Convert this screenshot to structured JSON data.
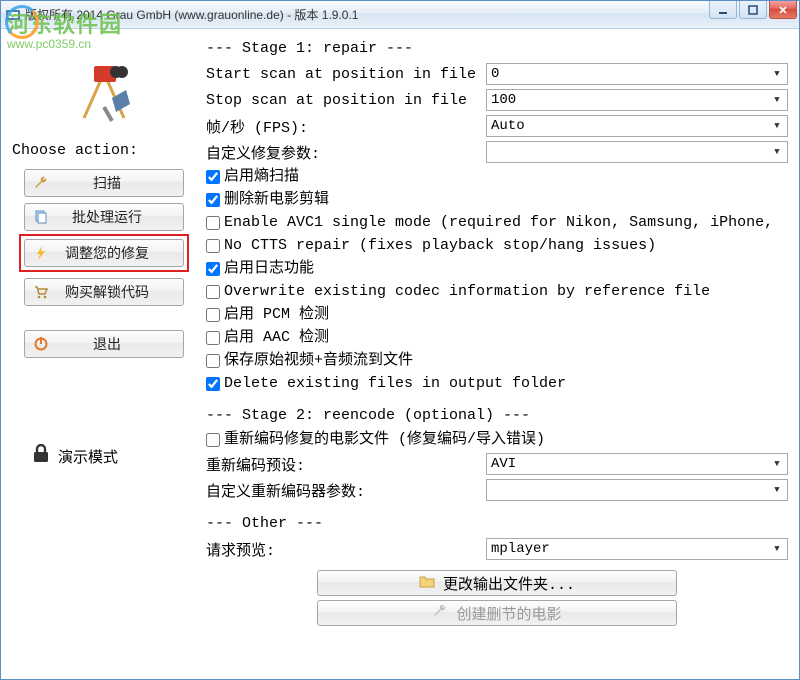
{
  "window": {
    "title": "版权所有 2014 Grau GmbH (www.grauonline.de) - 版本 1.9.0.1"
  },
  "watermark": {
    "text": "河东软件园",
    "sub": "www.pc0359.cn"
  },
  "sidebar": {
    "choose_label": "Choose action:",
    "buttons": {
      "scan": "扫描",
      "batch": "批处理运行",
      "adjust": "调整您的修复",
      "unlock": "购买解锁代码",
      "exit": "退出"
    },
    "demo_label": "演示模式"
  },
  "stage1": {
    "title": "--- Stage 1: repair ---",
    "start_label": "Start scan at position in file",
    "start_value": "0",
    "stop_label": "Stop scan at position in file",
    "stop_value": "100",
    "fps_label": "帧/秒 (FPS):",
    "fps_value": "Auto",
    "custom_label": "自定义修复参数:",
    "custom_value": "",
    "checks": [
      {
        "label": "启用熵扫描",
        "checked": true
      },
      {
        "label": "删除新电影剪辑",
        "checked": true
      },
      {
        "label": "Enable AVC1 single mode (required for Nikon, Samsung, iPhone,",
        "checked": false
      },
      {
        "label": "No CTTS repair (fixes playback stop/hang issues)",
        "checked": false
      },
      {
        "label": "启用日志功能",
        "checked": true
      },
      {
        "label": "Overwrite existing codec information by reference file",
        "checked": false
      },
      {
        "label": "启用 PCM 检测",
        "checked": false
      },
      {
        "label": "启用 AAC 检测",
        "checked": false
      },
      {
        "label": "保存原始视频+音频流到文件",
        "checked": false
      },
      {
        "label": "Delete existing files in output folder",
        "checked": true
      }
    ]
  },
  "stage2": {
    "title": "--- Stage 2: reencode (optional) ---",
    "reencode_label": "重新编码修复的电影文件 (修复编码/导入错误)",
    "reencode_checked": false,
    "preset_label": "重新编码预设:",
    "preset_value": "AVI",
    "custom_enc_label": "自定义重新编码器参数:",
    "custom_enc_value": ""
  },
  "other": {
    "title": "--- Other ---",
    "preview_label": "请求预览:",
    "preview_value": "mplayer"
  },
  "bottom": {
    "change_folder": "更改输出文件夹...",
    "create_cut": "创建删节的电影"
  }
}
